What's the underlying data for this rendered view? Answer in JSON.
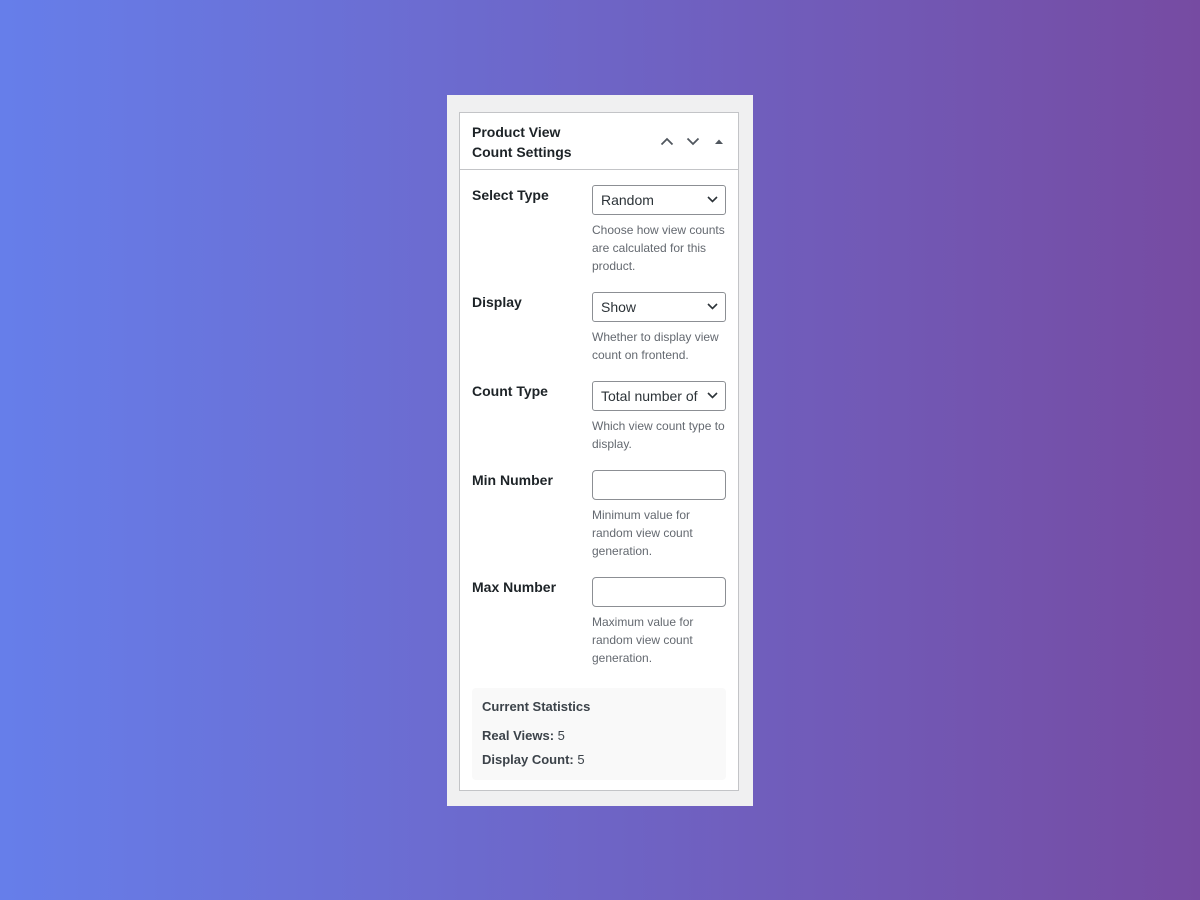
{
  "metabox": {
    "title": "Product View Count Settings",
    "icons": {
      "move_up": "chevron-up-icon",
      "move_down": "chevron-down-icon",
      "toggle": "triangle-up-icon"
    }
  },
  "fields": [
    {
      "label": "Select Type",
      "type": "select",
      "value": "Random",
      "description": "Choose how view counts are calculated for this product."
    },
    {
      "label": "Display",
      "type": "select",
      "value": "Show",
      "description": "Whether to display view count on frontend."
    },
    {
      "label": "Count Type",
      "type": "select",
      "value": "Total number of",
      "description": "Which view count type to display."
    },
    {
      "label": "Min Number",
      "type": "input",
      "value": "",
      "placeholder": "",
      "description": "Minimum value for random view count generation."
    },
    {
      "label": "Max Number",
      "type": "input",
      "value": "",
      "placeholder": "",
      "description": "Maximum value for random view count generation."
    }
  ],
  "stats": {
    "title": "Current Statistics",
    "real_views_label": "Real Views:",
    "real_views_value": "5",
    "display_count_label": "Display Count:",
    "display_count_value": "5"
  },
  "colors": {
    "gradient_start": "#667eea",
    "gradient_end": "#764ba2",
    "panel_bg": "#f0f0f1",
    "border": "#c3c4c7",
    "description": "#646970"
  }
}
